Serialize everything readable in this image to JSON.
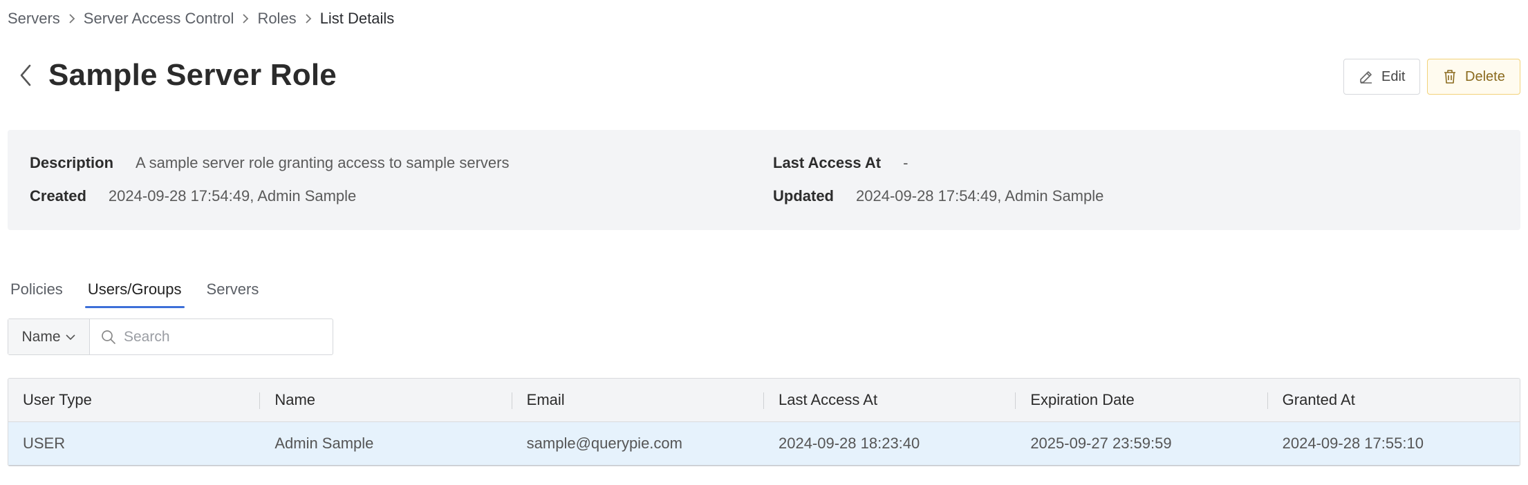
{
  "breadcrumb": {
    "items": [
      "Servers",
      "Server Access Control",
      "Roles",
      "List Details"
    ]
  },
  "header": {
    "title": "Sample Server Role",
    "edit_label": "Edit",
    "delete_label": "Delete"
  },
  "info": {
    "description_label": "Description",
    "description_value": "A sample server role granting access to sample servers",
    "created_label": "Created",
    "created_value": "2024-09-28 17:54:49, Admin Sample",
    "last_access_label": "Last Access At",
    "last_access_value": "-",
    "updated_label": "Updated",
    "updated_value": "2024-09-28 17:54:49, Admin Sample"
  },
  "tabs": [
    {
      "label": "Policies",
      "active": false
    },
    {
      "label": "Users/Groups",
      "active": true
    },
    {
      "label": "Servers",
      "active": false
    }
  ],
  "search": {
    "filter_label": "Name",
    "placeholder": "Search",
    "value": ""
  },
  "table": {
    "columns": [
      "User Type",
      "Name",
      "Email",
      "Last Access At",
      "Expiration Date",
      "Granted At"
    ],
    "rows": [
      [
        "USER",
        "Admin Sample",
        "sample@querypie.com",
        "2024-09-28 18:23:40",
        "2025-09-27 23:59:59",
        "2024-09-28 17:55:10"
      ]
    ]
  },
  "colors": {
    "accent": "#3d6fd8",
    "selected_row": "#e6f2fc",
    "delete_border": "#f2d27a",
    "panel_bg": "#f3f4f6"
  },
  "icons": {
    "back": "chevron-left-icon",
    "edit": "pencil-icon",
    "delete": "trash-icon",
    "search": "search-icon",
    "dropdown": "chevron-down-icon",
    "breadcrumb_sep": "chevron-right-icon"
  }
}
